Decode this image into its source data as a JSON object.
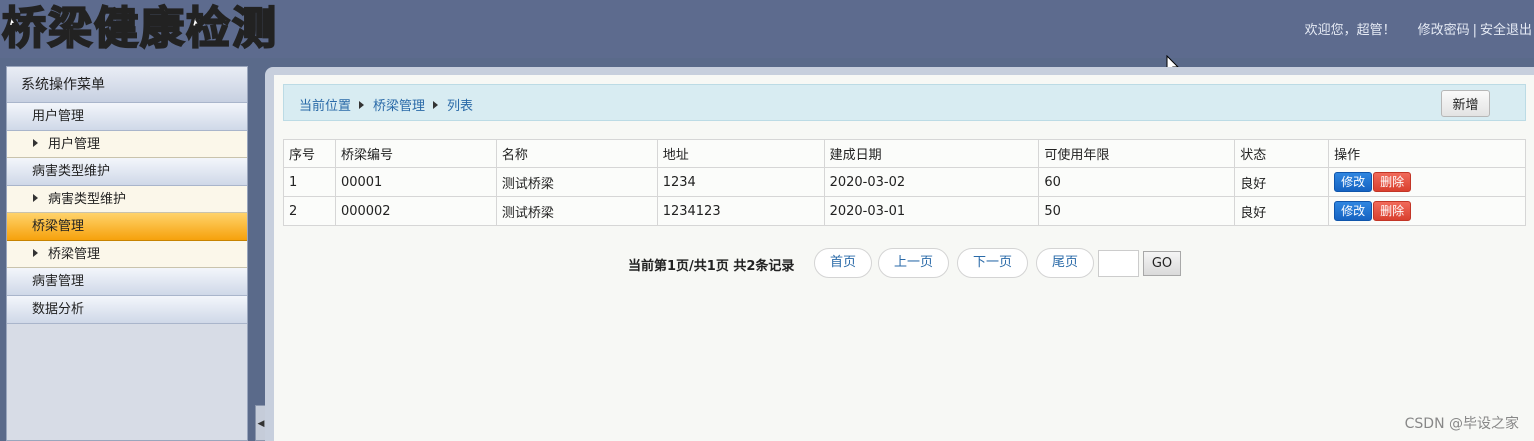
{
  "header": {
    "logo_text": "桥梁健康检测",
    "welcome": "欢迎您，超管！",
    "change_password": "修改密码",
    "separator": "|",
    "logout": "安全退出"
  },
  "sidebar": {
    "title": "系统操作菜单",
    "groups": [
      {
        "label": "用户管理",
        "items": [
          "用户管理"
        ]
      },
      {
        "label": "病害类型维护",
        "items": [
          "病害类型维护"
        ]
      },
      {
        "label": "桥梁管理",
        "items": [
          "桥梁管理"
        ],
        "active": true
      },
      {
        "label": "病害管理",
        "items": []
      },
      {
        "label": "数据分析",
        "items": []
      }
    ]
  },
  "breadcrumb": {
    "items": [
      "当前位置",
      "桥梁管理",
      "列表"
    ],
    "add_button": "新增"
  },
  "table": {
    "columns": [
      "序号",
      "桥梁编号",
      "名称",
      "地址",
      "建成日期",
      "可使用年限",
      "状态",
      "操作"
    ],
    "rows": [
      {
        "index": "1",
        "code": "00001",
        "name": "测试桥梁",
        "address": "1234",
        "built_date": "2020-03-02",
        "life_years": "60",
        "status": "良好"
      },
      {
        "index": "2",
        "code": "000002",
        "name": "测试桥梁",
        "address": "1234123",
        "built_date": "2020-03-01",
        "life_years": "50",
        "status": "良好"
      }
    ],
    "edit_label": "修改",
    "delete_label": "删除"
  },
  "pager": {
    "info": "当前第1页/共1页  共2条记录",
    "first": "首页",
    "prev": "上一页",
    "next": "下一页",
    "last": "尾页",
    "page_input_value": "",
    "go": "GO"
  },
  "watermark": "CSDN @毕设之家",
  "colors": {
    "header_bg": "#5d6b8e",
    "active_menu": "#f6a10c",
    "edit_button": "#1663c2",
    "delete_button": "#d9402f",
    "breadcrumb_bg": "#d8ecf2"
  }
}
